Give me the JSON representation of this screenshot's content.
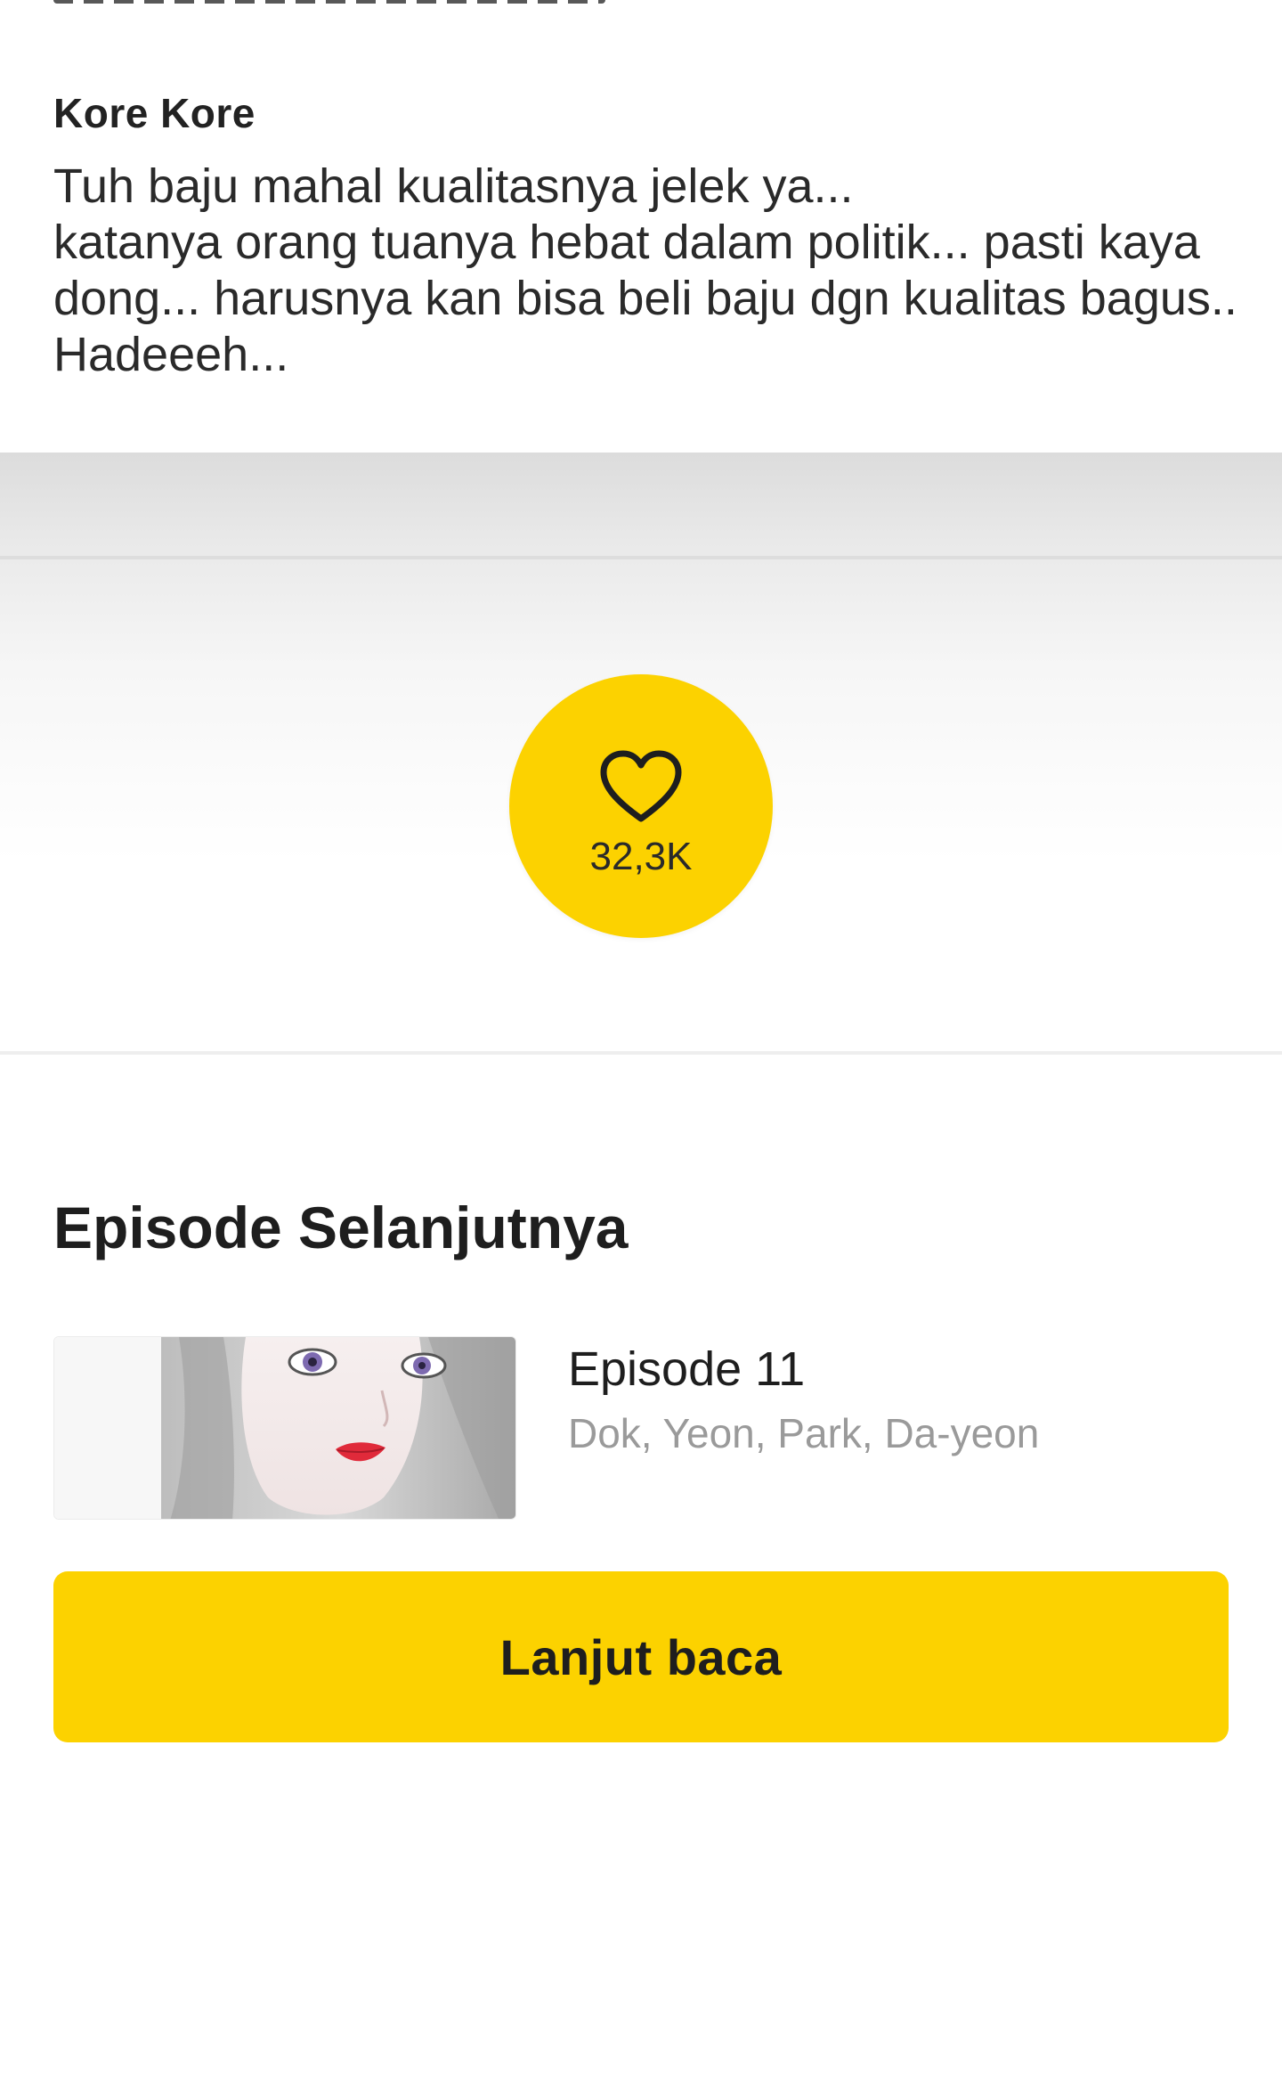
{
  "comment": {
    "author": "Kore Kore",
    "text": "Tuh baju mahal kualitasnya jelek ya...\nkatanya orang tuanya hebat dalam politik... pasti kaya dong... harusnya kan bisa beli baju dgn kualitas bagus..\nHadeeeh..."
  },
  "like": {
    "icon": "heart-outline-icon",
    "count": "32,3K"
  },
  "next_episode": {
    "section_title": "Episode Selanjutnya",
    "episode_title": "Episode 11",
    "authors": "Dok, Yeon, Park, Da-yeon",
    "thumbnail": "episode-thumbnail-silver-hair-girl"
  },
  "continue_button": {
    "label": "Lanjut baca"
  },
  "colors": {
    "accent": "#fcd200",
    "text_primary": "#1e1e1e",
    "text_secondary": "#9a9a9a"
  }
}
